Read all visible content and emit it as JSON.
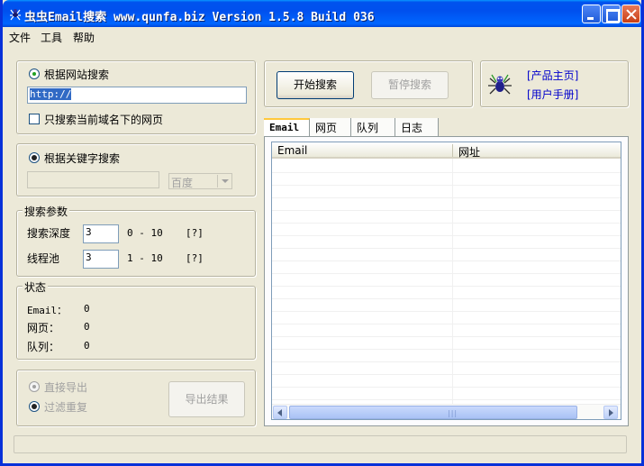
{
  "window": {
    "title": "虫虫Email搜索 www.qunfa.biz Version 1.5.8 Build 036"
  },
  "menu": [
    "文件",
    "工具",
    "帮助"
  ],
  "site_search": {
    "radio_label": "根据网站搜索",
    "url_value": "http://",
    "only_current_domain_label": "只搜索当前域名下的网页",
    "only_current_domain_checked": false
  },
  "keyword_search": {
    "radio_label": "根据关键字搜索",
    "keyword_value": "",
    "engine_selected": "百度"
  },
  "params": {
    "title": "搜索参数",
    "depth_label": "搜索深度",
    "depth_value": "3",
    "depth_range": "0 - 10",
    "depth_help": "[?]",
    "threads_label": "线程池",
    "threads_value": "3",
    "threads_range": "1 - 10",
    "threads_help": "[?]"
  },
  "status": {
    "title": "状态",
    "email_label": "Email：",
    "email_value": "0",
    "pages_label": "网页：",
    "pages_value": "0",
    "queue_label": "队列：",
    "queue_value": "0"
  },
  "export": {
    "direct_label": "直接导出",
    "filter_label": "过滤重复",
    "export_button": "导出结果"
  },
  "controls": {
    "start_button": "开始搜索",
    "pause_button": "暂停搜索"
  },
  "links": {
    "homepage": "[产品主页]",
    "manual": "[用户手册]"
  },
  "tabs": [
    "Email",
    "网页",
    "队列",
    "日志"
  ],
  "table": {
    "columns": [
      "Email",
      "网址"
    ],
    "rows": []
  },
  "statusbar_text": "",
  "colors": {
    "titlebar": "#0054e3",
    "window_bg": "#ece9d8",
    "link": "#0000cc",
    "selection": "#316ac5"
  }
}
